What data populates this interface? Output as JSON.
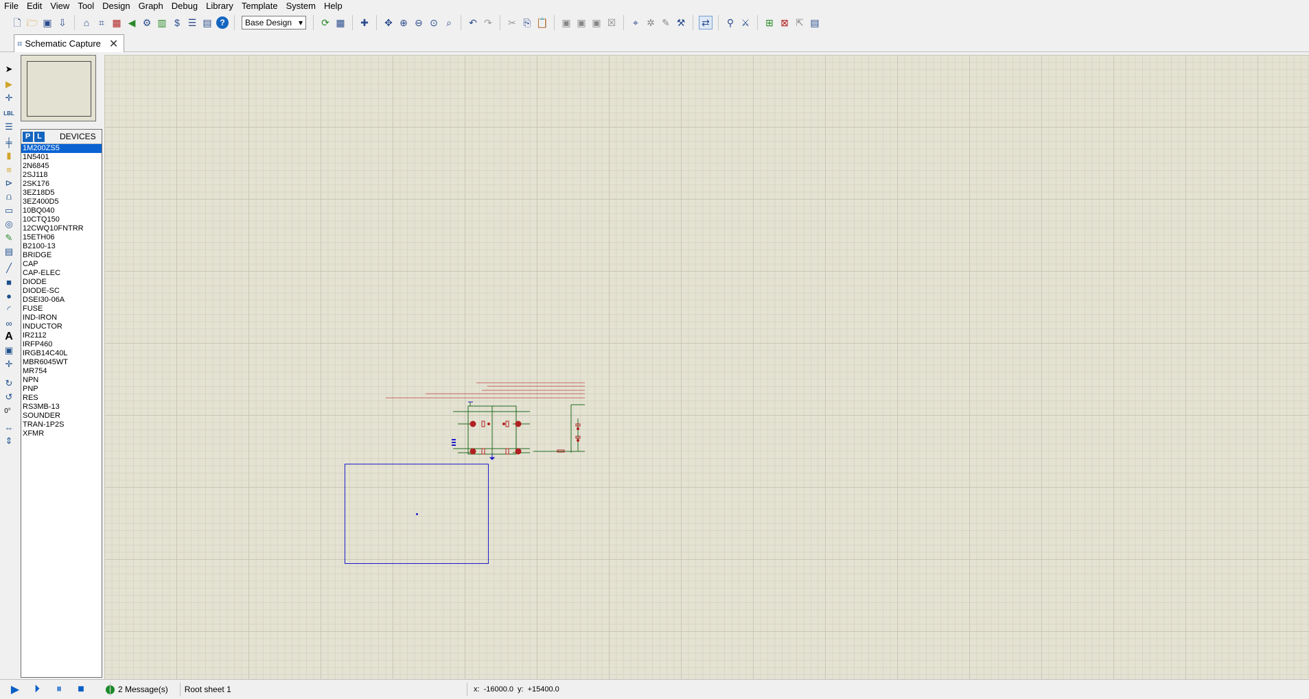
{
  "menu": [
    "File",
    "Edit",
    "View",
    "Tool",
    "Design",
    "Graph",
    "Debug",
    "Library",
    "Template",
    "System",
    "Help"
  ],
  "toolbar": {
    "design_select": "Base Design"
  },
  "tab": {
    "label": "Schematic Capture"
  },
  "devices": {
    "p_label": "P",
    "l_label": "L",
    "title": "DEVICES",
    "items": [
      "1M200ZS5",
      "1N5401",
      "2N6845",
      "2SJ118",
      "2SK176",
      "3EZ18D5",
      "3EZ400D5",
      "10BQ040",
      "10CTQ150",
      "12CWQ10FNTRR",
      "15ETH06",
      "B2100-13",
      "BRIDGE",
      "CAP",
      "CAP-ELEC",
      "DIODE",
      "DIODE-SC",
      "DSEI30-06A",
      "FUSE",
      "IND-IRON",
      "INDUCTOR",
      "IR2112",
      "IRFP460",
      "IRGB14C40L",
      "MBR6045WT",
      "MR754",
      "NPN",
      "PNP",
      "RES",
      "RS3MB-13",
      "SOUNDER",
      "TRAN-1P2S",
      "XFMR"
    ],
    "selected": "1M200ZS5"
  },
  "left_tools": {
    "rotation": "0°"
  },
  "status": {
    "messages": "2 Message(s)",
    "sheet": "Root sheet 1",
    "x_label": "x:",
    "x_value": "-16000.0",
    "y_label": "y:",
    "y_value": "+15400.0"
  },
  "colors": {
    "canvas_bg": "#e4e2d2",
    "grid": "#c9c6b5",
    "sheet_border": "#1a1ac8",
    "selection": "#0a63d1",
    "accent": "#0a5fc7"
  }
}
